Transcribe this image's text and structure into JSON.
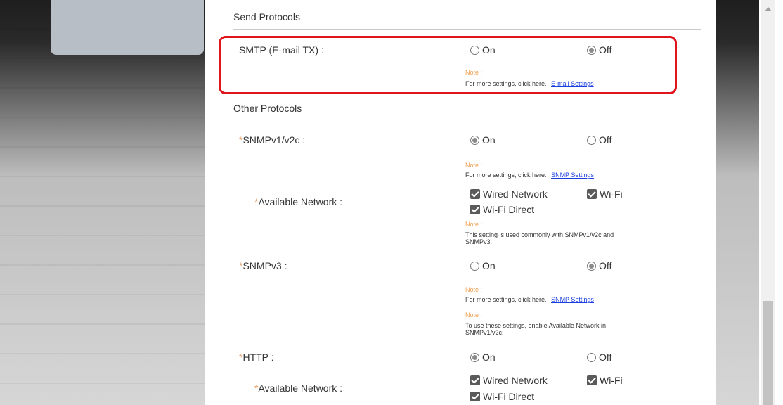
{
  "sections": {
    "send_protocols": "Send Protocols",
    "other_protocols": "Other Protocols"
  },
  "labels": {
    "required_mark": "*",
    "on": "On",
    "off": "Off",
    "note": "Note :",
    "more_settings": "For more settings, click here.",
    "wired_network": "Wired Network",
    "wifi": "Wi-Fi",
    "wifi_direct": "Wi-Fi Direct"
  },
  "smtp": {
    "label": "SMTP (E-mail TX) :",
    "selected": "Off",
    "link": "E-mail Settings"
  },
  "snmpv1": {
    "label": "SNMPv1/v2c :",
    "selected": "On",
    "link": "SNMP Settings",
    "available_network": {
      "label": "Available Network :",
      "note_line1": "This setting is used commonly with SNMPv1/v2c and",
      "note_line2": "SNMPv3."
    }
  },
  "snmpv3": {
    "label": "SNMPv3 :",
    "selected": "Off",
    "link": "SNMP Settings",
    "note2_line1": "To use these settings, enable Available Network in",
    "note2_line2": "SNMPv1/v2c."
  },
  "http": {
    "label": "HTTP :",
    "selected": "On",
    "available_network": {
      "label": "Available Network :"
    }
  },
  "colors": {
    "highlight": "#e0141c",
    "link": "#1a3ee0",
    "note": "#f0a050"
  }
}
